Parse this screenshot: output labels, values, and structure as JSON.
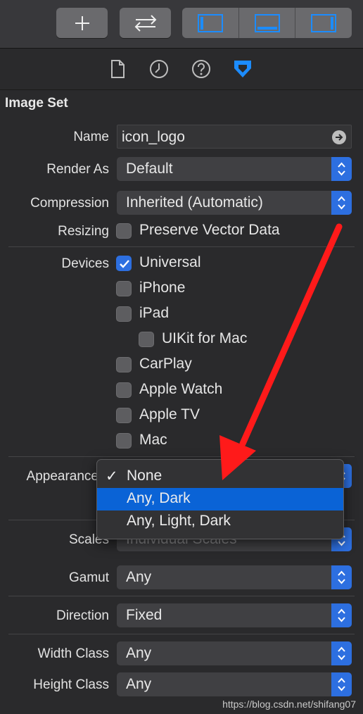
{
  "toolbar": {
    "buttons": [
      "add",
      "swap",
      "show-navigator",
      "show-debug",
      "show-inspector"
    ]
  },
  "inspector_tabs": [
    "file-inspector",
    "history-inspector",
    "quick-help",
    "attributes-inspector"
  ],
  "section_title": "Image Set",
  "fields": {
    "name": {
      "label": "Name",
      "value": "icon_logo"
    },
    "render_as": {
      "label": "Render As",
      "value": "Default"
    },
    "compression": {
      "label": "Compression",
      "value": "Inherited (Automatic)"
    },
    "resizing": {
      "label": "Resizing",
      "option": "Preserve Vector Data",
      "checked": false
    }
  },
  "devices": {
    "label": "Devices",
    "items": [
      {
        "label": "Universal",
        "checked": true
      },
      {
        "label": "iPhone",
        "checked": false
      },
      {
        "label": "iPad",
        "checked": false
      },
      {
        "label": "UIKit for Mac",
        "checked": false
      },
      {
        "label": "CarPlay",
        "checked": false
      },
      {
        "label": "Apple Watch",
        "checked": false
      },
      {
        "label": "Apple TV",
        "checked": false
      },
      {
        "label": "Mac",
        "checked": false
      }
    ]
  },
  "appearance": {
    "label": "Appearance",
    "menu": [
      "None",
      "Any, Dark",
      "Any, Light, Dark"
    ],
    "checked_item": "None",
    "highlighted_item": "Any, Dark"
  },
  "scales": {
    "label": "Scales",
    "value": "Individual Scales"
  },
  "gamut": {
    "label": "Gamut",
    "value": "Any"
  },
  "direction": {
    "label": "Direction",
    "value": "Fixed"
  },
  "width_class": {
    "label": "Width Class",
    "value": "Any"
  },
  "height_class": {
    "label": "Height Class",
    "value": "Any"
  },
  "watermark": "https://blog.csdn.net/shifang07",
  "colors": {
    "accent": "#2d6fe0",
    "highlight": "#0a63d6",
    "annotation": "#ff1a1a",
    "panel": "#2a2a2c"
  }
}
